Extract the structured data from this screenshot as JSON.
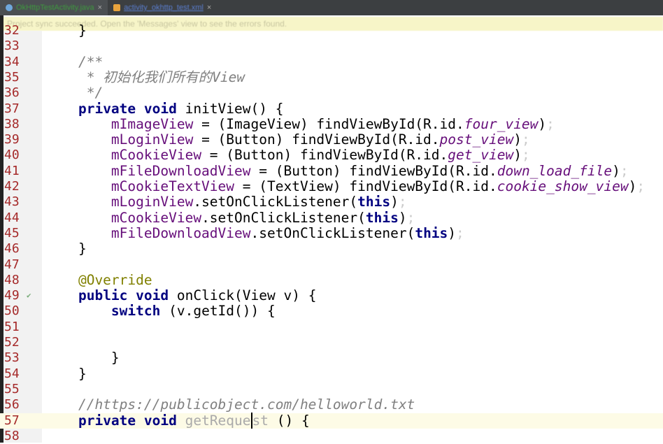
{
  "tabs": [
    {
      "label": "OkHttpTestActivity.java",
      "icon": "java-class-icon"
    },
    {
      "label": "activity_okhttp_test.xml",
      "icon": "xml-file-icon"
    }
  ],
  "notification": "Project sync succeeded. Open the 'Messages' view to see the errors found.",
  "lines": [
    {
      "n": "32",
      "t": [
        [
          "",
          "    }"
        ]
      ]
    },
    {
      "n": "33",
      "t": []
    },
    {
      "n": "34",
      "t": [
        [
          "cmt",
          "    /**"
        ]
      ]
    },
    {
      "n": "35",
      "t": [
        [
          "cmt",
          "     * 初始化我们所有的View"
        ]
      ]
    },
    {
      "n": "36",
      "t": [
        [
          "cmt",
          "     */"
        ]
      ]
    },
    {
      "n": "37",
      "t": [
        [
          "",
          "    "
        ],
        [
          "kw",
          "private void "
        ],
        [
          "",
          "initView() {"
        ]
      ]
    },
    {
      "n": "38",
      "t": [
        [
          "",
          "        "
        ],
        [
          "fld",
          "mImageView"
        ],
        [
          "",
          " = (ImageView) findViewById(R.id."
        ],
        [
          "ifld",
          "four_view"
        ],
        [
          "",
          ")"
        ],
        [
          "semi",
          ";"
        ]
      ]
    },
    {
      "n": "39",
      "t": [
        [
          "",
          "        "
        ],
        [
          "fld",
          "mLoginView"
        ],
        [
          "",
          " = (Button) findViewById(R.id."
        ],
        [
          "ifld",
          "post_view"
        ],
        [
          "",
          ")"
        ],
        [
          "semi",
          ";"
        ]
      ]
    },
    {
      "n": "40",
      "t": [
        [
          "",
          "        "
        ],
        [
          "fld",
          "mCookieView"
        ],
        [
          "",
          " = (Button) findViewById(R.id."
        ],
        [
          "ifld",
          "get_view"
        ],
        [
          "",
          ")"
        ],
        [
          "semi",
          ";"
        ]
      ]
    },
    {
      "n": "41",
      "t": [
        [
          "",
          "        "
        ],
        [
          "fld",
          "mFileDownloadView"
        ],
        [
          "",
          " = (Button) findViewById(R.id."
        ],
        [
          "ifld",
          "down_load_file"
        ],
        [
          "",
          ")"
        ],
        [
          "semi",
          ";"
        ]
      ]
    },
    {
      "n": "42",
      "t": [
        [
          "",
          "        "
        ],
        [
          "fld",
          "mCookieTextView"
        ],
        [
          "",
          " = (TextView) findViewById(R.id."
        ],
        [
          "ifld",
          "cookie_show_view"
        ],
        [
          "",
          ")"
        ],
        [
          "semi",
          ";"
        ]
      ]
    },
    {
      "n": "43",
      "t": [
        [
          "",
          "        "
        ],
        [
          "fld",
          "mLoginView"
        ],
        [
          "",
          ".setOnClickListener("
        ],
        [
          "kw",
          "this"
        ],
        [
          "",
          ")"
        ],
        [
          "semi",
          ";"
        ]
      ]
    },
    {
      "n": "44",
      "t": [
        [
          "",
          "        "
        ],
        [
          "fld",
          "mCookieView"
        ],
        [
          "",
          ".setOnClickListener("
        ],
        [
          "kw",
          "this"
        ],
        [
          "",
          ")"
        ],
        [
          "semi",
          ";"
        ]
      ]
    },
    {
      "n": "45",
      "t": [
        [
          "",
          "        "
        ],
        [
          "fld",
          "mFileDownloadView"
        ],
        [
          "",
          ".setOnClickListener("
        ],
        [
          "kw",
          "this"
        ],
        [
          "",
          ")"
        ],
        [
          "semi",
          ";"
        ]
      ]
    },
    {
      "n": "46",
      "t": [
        [
          "",
          "    }"
        ]
      ]
    },
    {
      "n": "47",
      "t": []
    },
    {
      "n": "48",
      "t": [
        [
          "ann",
          "    @Override"
        ]
      ]
    },
    {
      "n": "49",
      "mark": "✔",
      "t": [
        [
          "",
          "    "
        ],
        [
          "kw",
          "public void "
        ],
        [
          "",
          "onClick(View v) {"
        ]
      ]
    },
    {
      "n": "50",
      "t": [
        [
          "",
          "        "
        ],
        [
          "kw",
          "switch"
        ],
        [
          "",
          " (v.getId()) {"
        ]
      ]
    },
    {
      "n": "51",
      "t": []
    },
    {
      "n": "52",
      "t": []
    },
    {
      "n": "53",
      "t": [
        [
          "",
          "        }"
        ]
      ]
    },
    {
      "n": "54",
      "t": [
        [
          "",
          "    }"
        ]
      ]
    },
    {
      "n": "55",
      "t": []
    },
    {
      "n": "56",
      "t": [
        [
          "cmt",
          "    //https://publicobject.com/helloworld.txt"
        ]
      ]
    },
    {
      "n": "57",
      "cur": true,
      "t": [
        [
          "",
          "    "
        ],
        [
          "kw",
          "private void "
        ],
        [
          "dim",
          "getReque"
        ],
        [
          "dim caret",
          "st"
        ],
        [
          "",
          " () {"
        ]
      ]
    },
    {
      "n": "58",
      "t": []
    }
  ]
}
